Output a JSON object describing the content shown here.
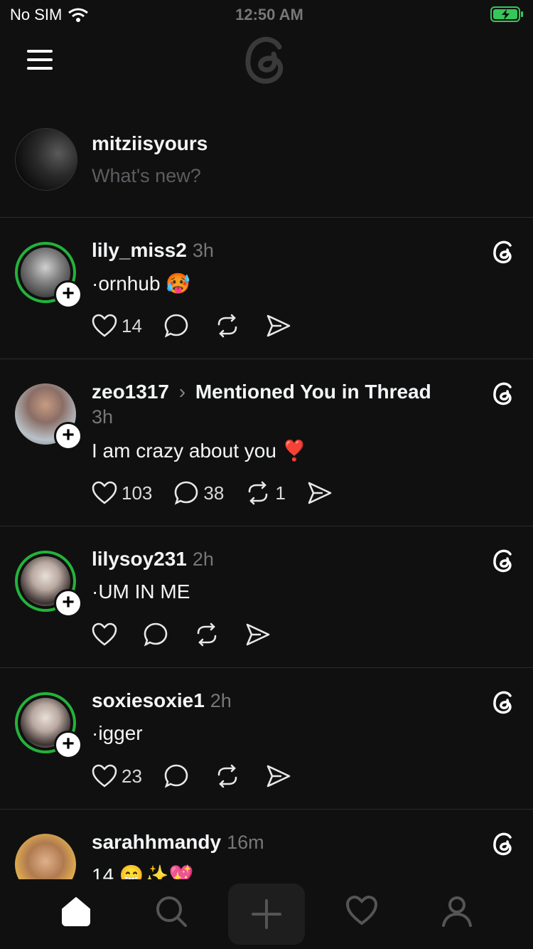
{
  "status_bar": {
    "carrier": "No SIM",
    "time": "12:50 AM"
  },
  "composer": {
    "username": "mitziisyours",
    "placeholder": "What's new?"
  },
  "posts": [
    {
      "username": "lily_miss2",
      "time": "3h",
      "text": "·ornhub 🥵",
      "likes": "14",
      "replies": "",
      "reposts": ""
    },
    {
      "username": "zeo1317",
      "context": "Mentioned You in Thread",
      "time": "3h",
      "text": "I am crazy about you ❣️",
      "likes": "103",
      "replies": "38",
      "reposts": "1"
    },
    {
      "username": "lilysoy231",
      "time": "2h",
      "text": "·UM IN ME",
      "likes": "",
      "replies": "",
      "reposts": ""
    },
    {
      "username": "soxiesoxie1",
      "time": "2h",
      "text": "·igger",
      "likes": "23",
      "replies": "",
      "reposts": ""
    },
    {
      "username": "sarahhmandy",
      "time": "16m",
      "text": "14 😁✨💖"
    }
  ],
  "tabs": [
    "home-icon",
    "search-icon",
    "new-thread-icon",
    "activity-icon",
    "profile-icon"
  ],
  "colors": {
    "background": "#101010",
    "ring": "#23b33a",
    "battery": "#35c759"
  }
}
